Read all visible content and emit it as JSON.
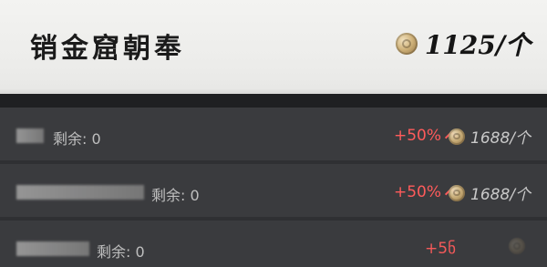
{
  "header": {
    "title": "销金窟朝奉",
    "price": "1125/个"
  },
  "rows": [
    {
      "remaining": "剩余: 0",
      "change": "+50%",
      "price": "1688/个"
    },
    {
      "remaining": "剩余: 0",
      "change": "+50%",
      "price": "1688/个"
    },
    {
      "remaining": "剩余: 0",
      "change": "+5ნ",
      "price": ""
    }
  ],
  "colors": {
    "header_bg": "#efefed",
    "row_bg": "#3a3b3e",
    "increase_red": "#ff5b5b",
    "coin_gold": "#cfb27a"
  },
  "icons": {
    "currency": "coin-icon",
    "change_indicator": "arrow-up-icon"
  }
}
